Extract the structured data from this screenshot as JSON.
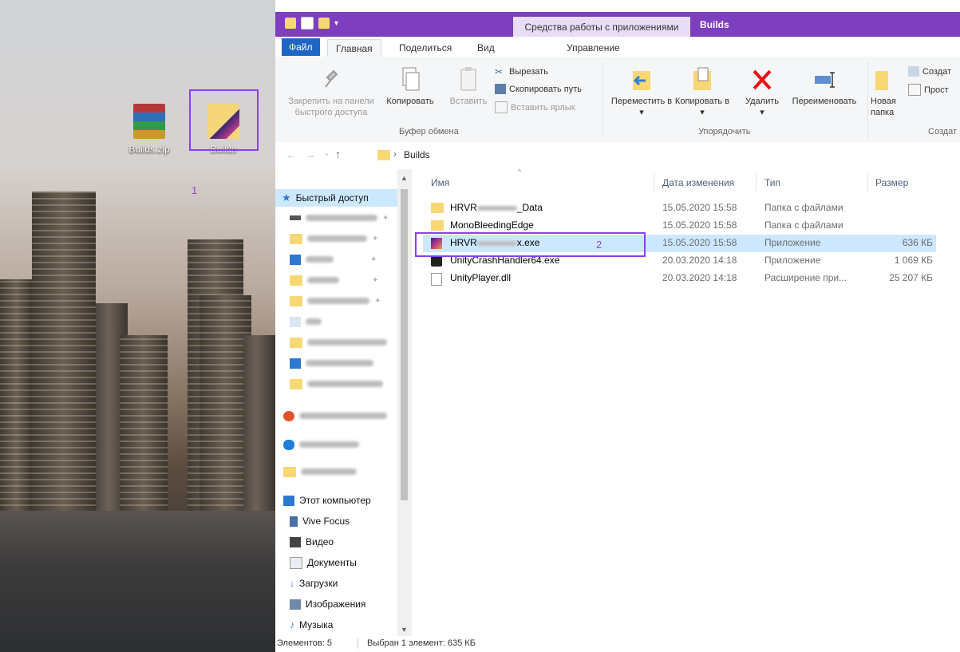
{
  "desktop": {
    "icons": [
      {
        "label": "Builds.zip"
      },
      {
        "label": "Builds"
      }
    ],
    "annotation_1": "1"
  },
  "explorer": {
    "ctx_tab_label": "Средства работы с приложениями",
    "window_title": "Builds",
    "tabs": {
      "file": "Файл",
      "home": "Главная",
      "share": "Поделиться",
      "view": "Вид",
      "manage": "Управление"
    },
    "ribbon": {
      "pin": "Закрепить на панели быстрого доступа",
      "copy": "Копировать",
      "paste": "Вставить",
      "cut": "Вырезать",
      "copy_path": "Скопировать путь",
      "paste_shortcut": "Вставить ярлык",
      "clipboard_group": "Буфер обмена",
      "move_to": "Переместить в",
      "copy_to": "Копировать в",
      "delete": "Удалить",
      "rename": "Переименовать",
      "organize_group": "Упорядочить",
      "new_folder": "Новая папка",
      "create1": "Создат",
      "create2": "Прост",
      "new_group": "Создат"
    },
    "address": {
      "crumb": "Builds"
    },
    "nav": {
      "quick_access": "Быстрый доступ",
      "this_pc": "Этот компьютер",
      "vive": "Vive Focus",
      "video": "Видео",
      "docs": "Документы",
      "downloads": "Загрузки",
      "images": "Изображения",
      "music": "Музыка"
    },
    "columns": {
      "name": "Имя",
      "date": "Дата изменения",
      "type": "Тип",
      "size": "Размер"
    },
    "files": [
      {
        "name_prefix": "HRVR",
        "name_suffix": "_Data",
        "date": "15.05.2020 15:58",
        "type": "Папка с файлами",
        "size": ""
      },
      {
        "name_prefix": "MonoBleedingEdge",
        "name_suffix": "",
        "date": "15.05.2020 15:58",
        "type": "Папка с файлами",
        "size": ""
      },
      {
        "name_prefix": "HRVR",
        "name_suffix": "x.exe",
        "date": "15.05.2020 15:58",
        "type": "Приложение",
        "size": "636 КБ"
      },
      {
        "name_prefix": "UnityCrashHandler64.exe",
        "name_suffix": "",
        "date": "20.03.2020 14:18",
        "type": "Приложение",
        "size": "1 069 КБ"
      },
      {
        "name_prefix": "UnityPlayer.dll",
        "name_suffix": "",
        "date": "20.03.2020 14:18",
        "type": "Расширение при...",
        "size": "25 207 КБ"
      }
    ],
    "annotation_2": "2",
    "status": {
      "count": "Элементов: 5",
      "selected": "Выбран 1 элемент: 635 КБ"
    }
  },
  "colors": {
    "titlebar": "#7d3fbf",
    "selection": "#cce8ff",
    "annotation": "#8a3ff0",
    "file_tab": "#1f65c6"
  }
}
